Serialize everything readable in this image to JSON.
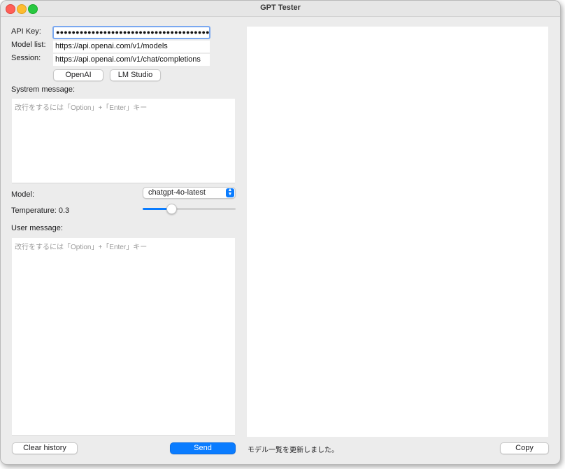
{
  "window": {
    "title": "GPT Tester"
  },
  "labels": {
    "api_key": "API Key:",
    "model_list": "Model list:",
    "session": "Session:",
    "system_message": "Systrem message:",
    "model": "Model:",
    "temperature": "Temperature: 0.3",
    "user_message": "User message:"
  },
  "fields": {
    "api_key_value": "●●●●●●●●●●●●●●●●●●●●●●●●●●●●●●●●●●●●●●●",
    "model_list_value": "https://api.openai.com/v1/models",
    "session_value": "https://api.openai.com/v1/chat/completions"
  },
  "presets": {
    "openai": "OpenAI",
    "lm_studio": "LM Studio"
  },
  "system_placeholder": "改行をするには「Option」+「Enter」キー",
  "user_placeholder": "改行をするには「Option」+「Enter」キー",
  "model_select": {
    "selected": "chatgpt-4o-latest"
  },
  "temperature_slider": {
    "value": 0.3,
    "min": 0,
    "max": 1
  },
  "buttons": {
    "clear_history": "Clear history",
    "send": "Send",
    "copy": "Copy"
  },
  "status": "モデル一覧を更新しました。",
  "colors": {
    "accent": "#0a7cff",
    "window_bg": "#ececec"
  }
}
